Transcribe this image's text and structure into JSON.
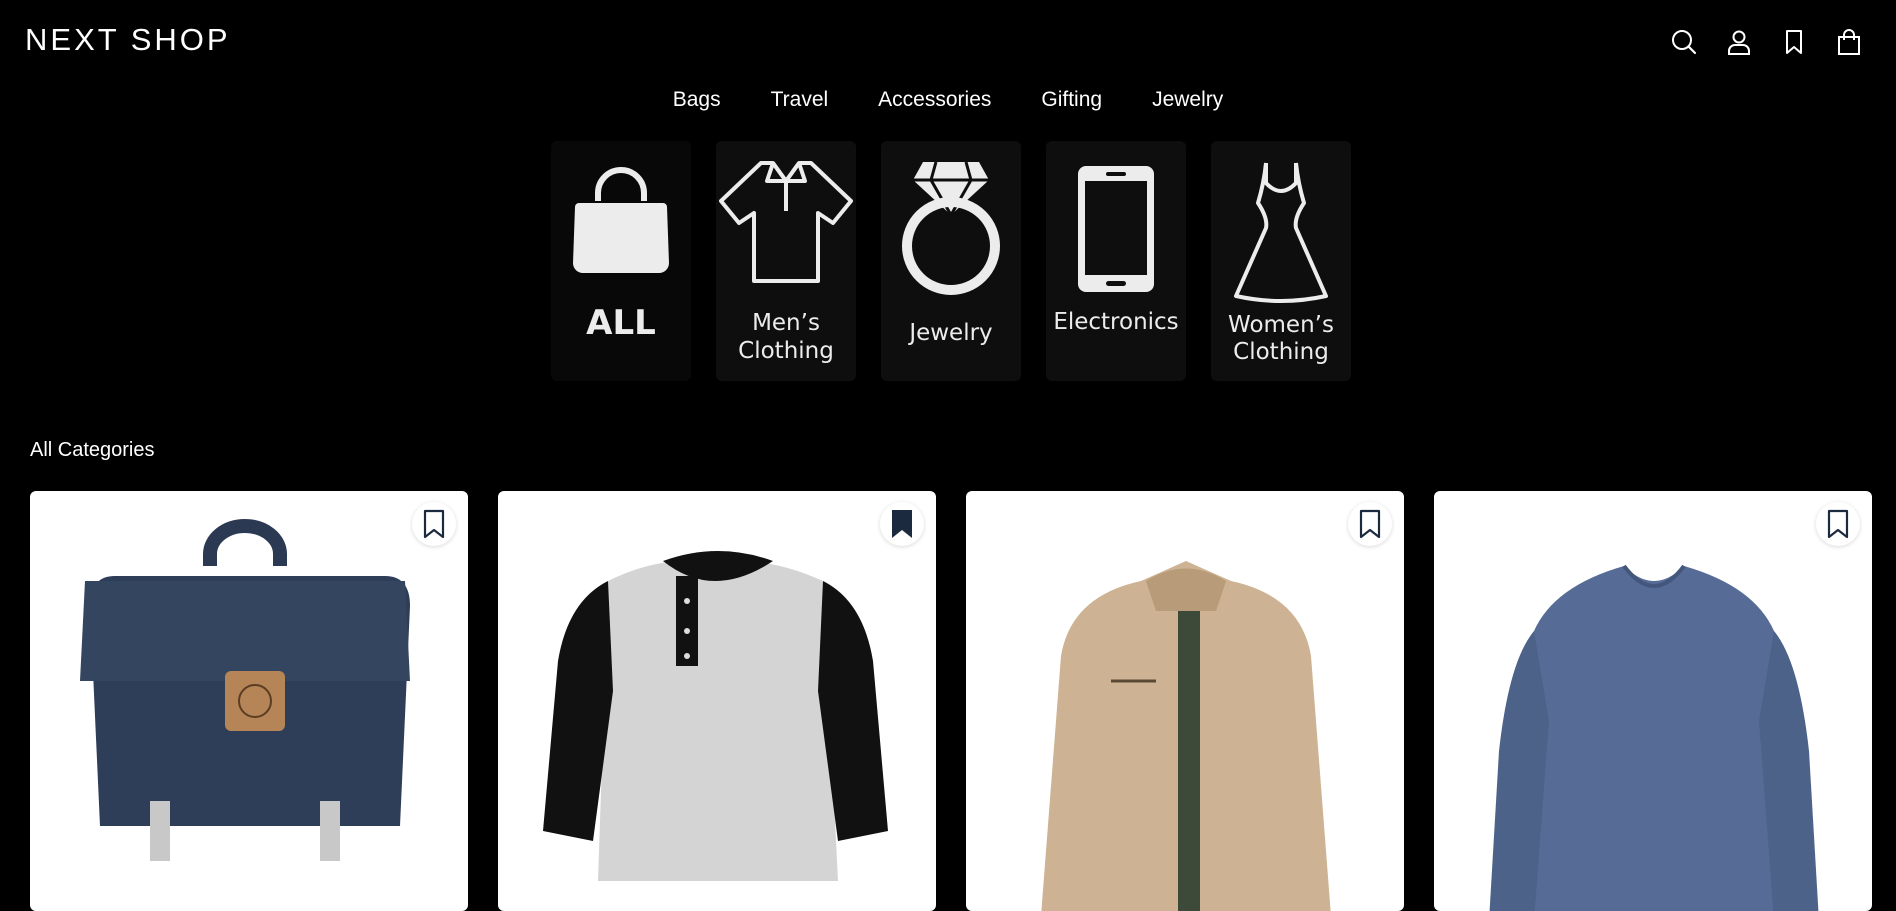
{
  "header": {
    "logo": "NEXT SHOP",
    "icons": [
      "search-icon",
      "user-icon",
      "bookmark-icon",
      "shopping-bag-icon"
    ]
  },
  "nav": {
    "items": [
      {
        "label": "Bags"
      },
      {
        "label": "Travel"
      },
      {
        "label": "Accessories"
      },
      {
        "label": "Gifting"
      },
      {
        "label": "Jewelry"
      }
    ]
  },
  "categories": [
    {
      "label": "ALL",
      "icon": "shopping-bag-icon"
    },
    {
      "label1": "Men’s",
      "label2": "Clothing",
      "icon": "polo-shirt-icon"
    },
    {
      "label": "Jewelry",
      "icon": "diamond-ring-icon"
    },
    {
      "label": "Electronics",
      "icon": "smartphone-icon"
    },
    {
      "label1": "Women’s",
      "label2": "Clothing",
      "icon": "dress-icon"
    }
  ],
  "section": {
    "title": "All Categories"
  },
  "products": [
    {
      "name": "backpack",
      "bookmarked": false
    },
    {
      "name": "raglan-henley-shirt",
      "bookmarked": true
    },
    {
      "name": "beige-jacket",
      "bookmarked": false
    },
    {
      "name": "blue-long-sleeve-tee",
      "bookmarked": false
    }
  ],
  "colors": {
    "background": "#000000",
    "tile": "#0e0e0e",
    "card": "#ffffff",
    "bookmark_filled": "#1c2a40"
  }
}
